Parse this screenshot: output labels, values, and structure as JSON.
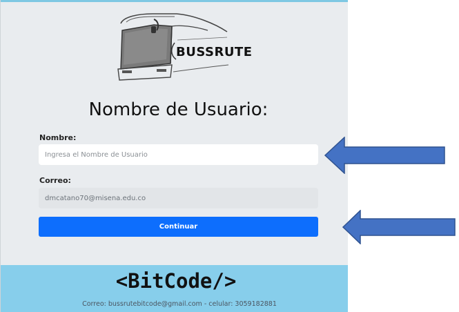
{
  "form": {
    "title": "Nombre de Usuario:",
    "name_label": "Nombre:",
    "name_placeholder": "Ingresa el Nombre de Usuario",
    "name_value": "",
    "email_label": "Correo:",
    "email_value": "dmcatano70@misena.edu.co",
    "submit_label": "Continuar"
  },
  "logo": {
    "text": "BUSSRUTE",
    "icon": "bus-icon"
  },
  "footer": {
    "brand": "<BitCode/>",
    "contact": "Correo: bussrutebitcode@gmail.com - celular: 3059182881"
  },
  "annotations": {
    "arrow_icon": "left-arrow-icon",
    "arrow_color": "#4472c4"
  },
  "colors": {
    "accent": "#0d6efd",
    "footer_bg": "#87ceeb",
    "panel_bg": "#e9ecef"
  }
}
